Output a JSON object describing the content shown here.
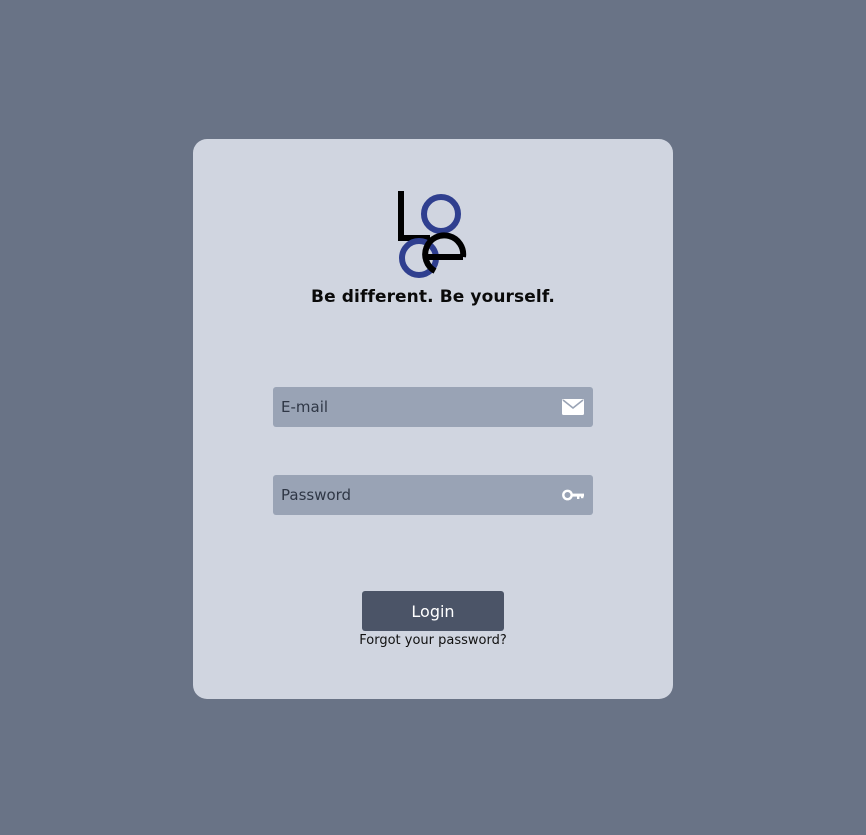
{
  "brand": {
    "logo_text": "LOGO",
    "tagline": "Be different. Be yourself.",
    "colors": {
      "logo_primary": "#000000",
      "logo_accent": "#2f3f8f"
    }
  },
  "login_form": {
    "email": {
      "placeholder": "E-mail",
      "value": "",
      "icon": "mail-icon"
    },
    "password": {
      "placeholder": "Password",
      "value": "",
      "icon": "key-icon"
    },
    "submit_label": "Login",
    "forgot_label": "Forgot your password?"
  },
  "colors": {
    "background": "#697386",
    "card": "#d0d5e0",
    "field": "#99a3b5",
    "button": "#4b5467"
  }
}
